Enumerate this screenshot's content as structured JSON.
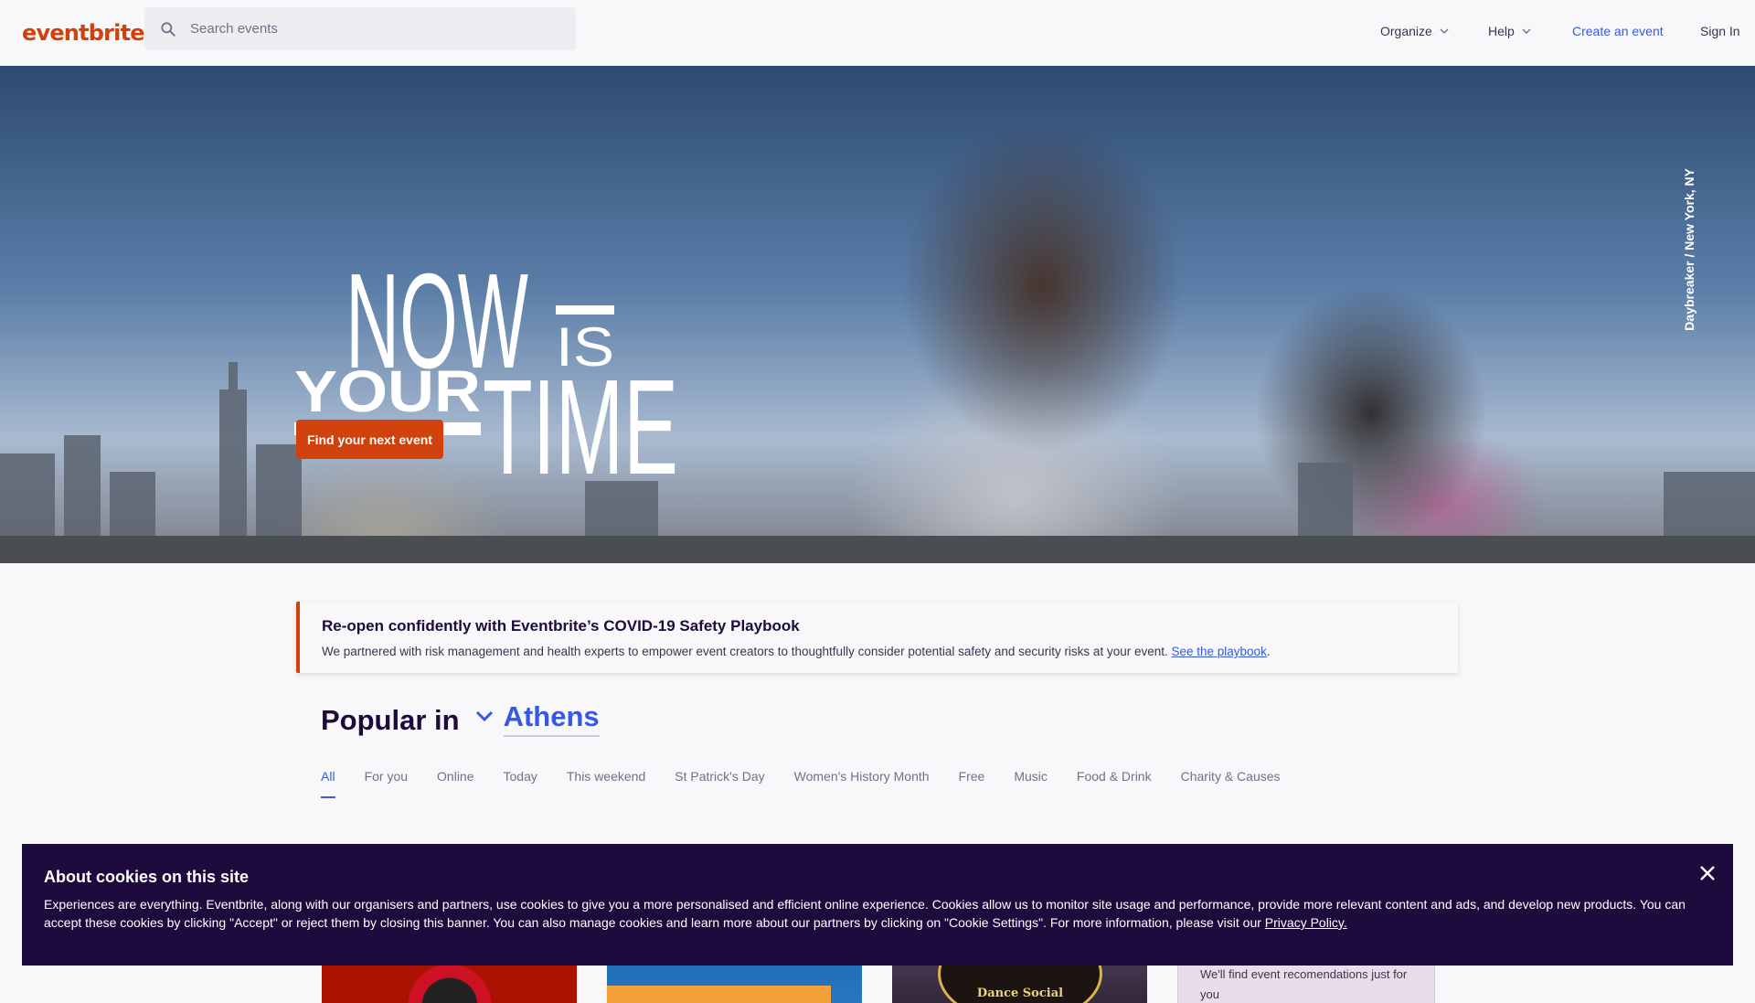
{
  "header": {
    "logo": "eventbrite",
    "search_placeholder": "Search events",
    "nav": {
      "organize": "Organize",
      "help": "Help",
      "create_event": "Create an event",
      "sign_in": "Sign In"
    }
  },
  "hero": {
    "title_now": "NOW",
    "title_is": "IS",
    "title_your": "YOUR",
    "title_time": "TIME",
    "cta_label": "Find your next event",
    "photo_credit": "Daybreaker / New York, NY"
  },
  "covid_banner": {
    "title": "Re-open confidently with Eventbrite’s COVID-19 Safety Playbook",
    "text": "We partnered with risk management and health experts to empower event creators to thoughtfully consider potential safety and security risks at your event. ",
    "link": "See the playbook",
    "after_link": "."
  },
  "popular": {
    "label": "Popular in",
    "city": "Athens",
    "tabs": [
      "All",
      "For you",
      "Online",
      "Today",
      "This weekend",
      "St Patrick's Day",
      "Women's History Month",
      "Free",
      "Music",
      "Food & Drink",
      "Charity & Causes"
    ],
    "active_tab": "All"
  },
  "cards": {
    "card3_text": "Dance Social",
    "card4_text": "We'll find event recomendations just for you"
  },
  "cookie_banner": {
    "title": "About cookies on this site",
    "text": "Experiences are everything. Eventbrite, along with our organisers and partners, use cookies to give you a more personalised and efficient online experience. Cookies allow us to monitor site usage and performance, provide more relevant content and ads, and develop new products. You can accept these cookies by clicking \"Accept\" or reject them by closing this banner. You can also manage cookies and learn more about our partners by clicking on \"Cookie Settings\". For more information, please visit our ",
    "link": "Privacy Policy."
  },
  "colors": {
    "brand": "#d1410c",
    "link": "#3659e3",
    "banner_bg": "#1e0a3c"
  },
  "icons": {
    "search": "search-icon",
    "chevron": "chevron-down-icon",
    "close": "close-icon"
  }
}
